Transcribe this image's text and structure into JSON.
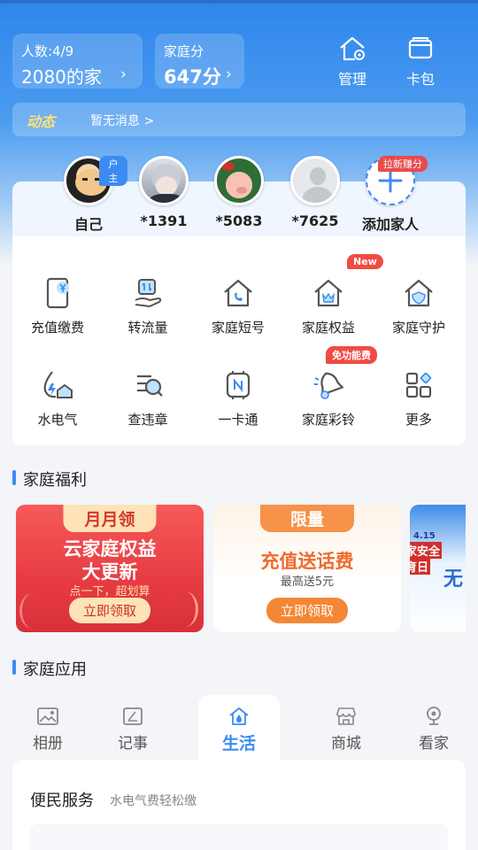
{
  "header": {
    "members_label": "人数:4/9",
    "family_name": "2080的家",
    "score_label": "家庭分",
    "score_value": "647分",
    "manage_label": "管理",
    "wallet_label": "卡包"
  },
  "news": {
    "tag": "动态",
    "message": "暂无消息 >"
  },
  "members": [
    {
      "name": "自己",
      "badge": "户主"
    },
    {
      "name": "*1391"
    },
    {
      "name": "*5083"
    },
    {
      "name": "*7625"
    },
    {
      "name": "添加家人",
      "badge": "拉新赚分"
    }
  ],
  "services": [
    {
      "label": "充值缴费",
      "icon": "phone-yen-icon"
    },
    {
      "label": "转流量",
      "icon": "data-transfer-icon"
    },
    {
      "label": "家庭短号",
      "icon": "home-phone-icon"
    },
    {
      "label": "家庭权益",
      "icon": "home-crown-icon",
      "badge": "New"
    },
    {
      "label": "家庭守护",
      "icon": "home-shield-icon"
    },
    {
      "label": "水电气",
      "icon": "utilities-icon"
    },
    {
      "label": "查违章",
      "icon": "traffic-violation-icon"
    },
    {
      "label": "一卡通",
      "icon": "nfc-card-icon"
    },
    {
      "label": "家庭彩铃",
      "icon": "ringtone-icon",
      "badge": "免功能费"
    },
    {
      "label": "更多",
      "icon": "more-grid-icon"
    }
  ],
  "welfare": {
    "title": "家庭福利",
    "cards": [
      {
        "head": "月月领",
        "line1": "云家庭权益",
        "line2": "大更新",
        "sub": "点一下，超划算",
        "button": "立即领取"
      },
      {
        "head": "限量",
        "line1": "充值送话费",
        "sub": "最高送5元",
        "button": "立即领取"
      },
      {
        "line_top": "4.15",
        "line1": "国家安全",
        "line2": "教育日",
        "extra": "无"
      }
    ]
  },
  "apps": {
    "title": "家庭应用",
    "tabs": [
      {
        "label": "相册",
        "icon": "photo-icon"
      },
      {
        "label": "记事",
        "icon": "note-icon"
      },
      {
        "label": "生活",
        "icon": "home-drop-icon",
        "active": true
      },
      {
        "label": "商城",
        "icon": "store-icon"
      },
      {
        "label": "看家",
        "icon": "camera-icon"
      }
    ]
  },
  "panel": {
    "title": "便民服务",
    "subtitle": "水电气费轻松缴"
  },
  "colors": {
    "accent": "#3d8bf2",
    "red": "#ef4c45",
    "orange": "#f39a3d"
  }
}
